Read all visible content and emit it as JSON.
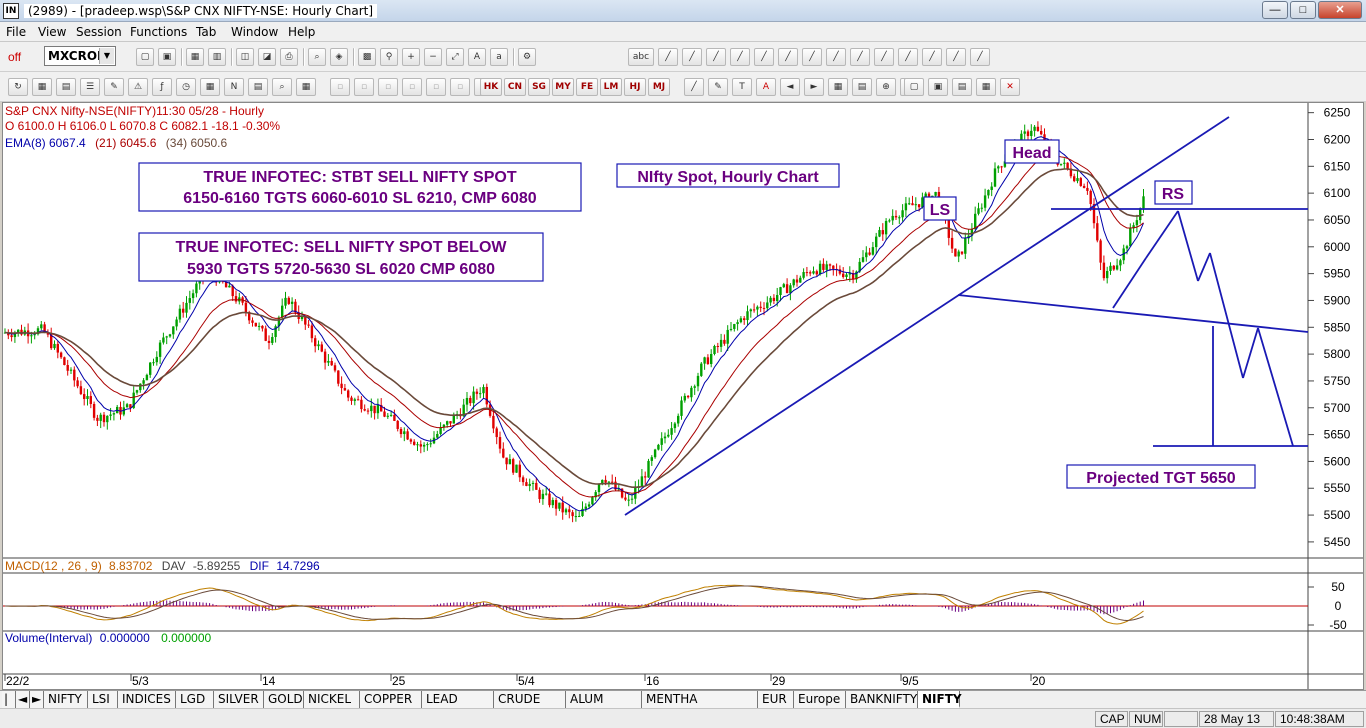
{
  "window": {
    "app_icon": "IN",
    "title": "(2989) - [pradeep.wsp\\S&P CNX NIFTY-NSE: Hourly Chart]",
    "minimize": "—",
    "restore": "□",
    "close": "✕"
  },
  "menu": [
    "File",
    "View",
    "Session",
    "Functions",
    "Tab",
    "Window",
    "Help"
  ],
  "toolbar": {
    "off_label": "off",
    "combo_value": "MXCROM",
    "text_tool": "abc",
    "region_buttons": [
      "HK",
      "CN",
      "SG",
      "MY",
      "FE",
      "LM",
      "HJ",
      "MJ"
    ],
    "text_T": "T",
    "text_A": "A"
  },
  "chart": {
    "header_line1": "S&P CNX Nifty-NSE(NIFTY)11:30 05/28   - Hourly",
    "header_line2": "O 6100.0 H 6106.0 L 6070.8 C 6082.1  -18.1  -0.30%",
    "ema_label": "EMA(8)",
    "ema_values": [
      {
        "label": "EMA(8) 6067.4"
      },
      {
        "label": "(21) 6045.6"
      },
      {
        "label": "(34) 6050.6"
      }
    ],
    "annotations": {
      "box1_line1": "TRUE INFOTEC: STBT SELL NIFTY SPOT",
      "box1_line2": "6150-6160 TGTS 6060-6010 SL 6210, CMP 6080",
      "box2_line1": "TRUE INFOTEC: SELL NIFTY SPOT BELOW",
      "box2_line2": "5930 TGTS 5720-5630 SL 6020 CMP 6080",
      "chart_title": "NIfty Spot, Hourly Chart",
      "head": "Head",
      "ls": "LS",
      "rs": "RS",
      "projected": "Projected TGT 5650"
    },
    "price_ticks": [
      6250,
      6200,
      6150,
      6100,
      6050,
      6000,
      5950,
      5900,
      5850,
      5800,
      5750,
      5700,
      5650,
      5600,
      5550,
      5500,
      5450
    ],
    "macd_label": "MACD(12 , 26 , 9)",
    "macd_value": "8.83702",
    "dav_label": "DAV",
    "dav_value": "-5.89255",
    "dif_label": "DIF",
    "dif_value": "14.7296",
    "macd_ticks": [
      "50",
      "0",
      "-50"
    ],
    "volume_label": "Volume(Interval)",
    "volume_value1": "0.000000",
    "volume_value2": "0.000000",
    "date_ticks": [
      "22/2",
      "5/3",
      "14",
      "25",
      "5/4",
      "16",
      "29",
      "9/5",
      "20"
    ]
  },
  "colors": {
    "up_candle": "#00a000",
    "down_candle": "#e00000",
    "annotation_blue": "#1a1ab4",
    "annotation_text": "#6a0080",
    "ema_short": "#0000aa",
    "ema_mid": "#aa0000",
    "ema_long": "#6a4a3a"
  },
  "tabs": [
    "NIFTY",
    "LSI",
    "INDICES",
    "LGD",
    "SILVER",
    "GOLD",
    "NICKEL",
    "COPPER",
    "LEAD ZINC",
    "CRUDE OIL",
    "ALUM NGAS",
    "MENTHA CARDAMOM",
    "EUR",
    "Europe",
    "BANKNIFTY",
    "NIFTY"
  ],
  "tab_nav": [
    "|◄",
    "◄",
    "►"
  ],
  "status": {
    "cap": "CAP",
    "num": "NUM",
    "date": "28 May 13",
    "time": "10:48:38AM"
  }
}
